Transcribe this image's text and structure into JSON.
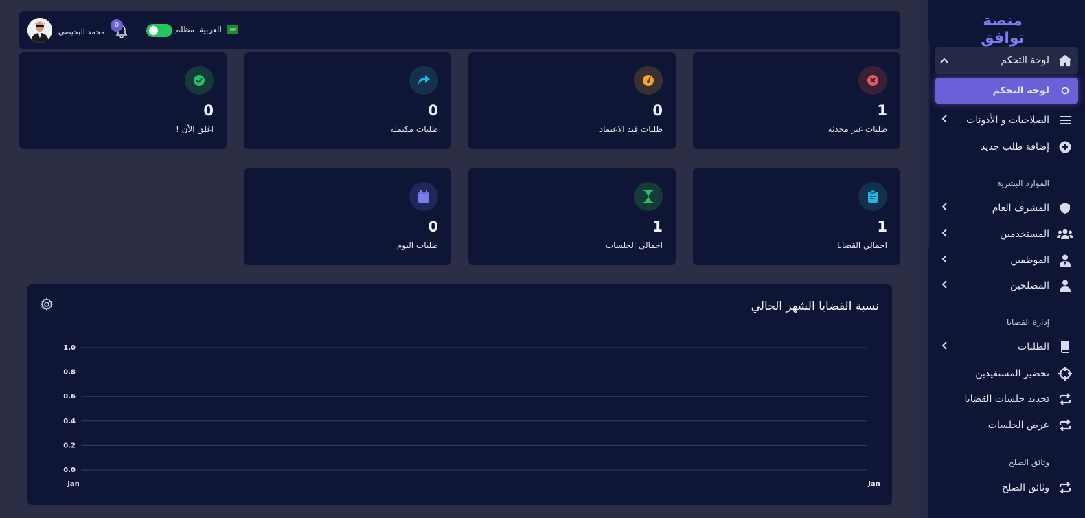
{
  "sidebar": {
    "brand": "منصة توافق",
    "items": [
      {
        "label": "لوحة التحكم",
        "icon": "home-icon",
        "chevron": "up"
      },
      {
        "label": "لوحة التحكم",
        "icon": "circle-icon"
      },
      {
        "label": "الصلاحيات و الأذونات",
        "icon": "menu-icon",
        "chevron": "left"
      },
      {
        "label": "إضافة طلب جديد",
        "icon": "plus-circle-icon"
      },
      {
        "label": "المشرف العام",
        "icon": "shield-icon",
        "chevron": "left"
      },
      {
        "label": "المستخدمين",
        "icon": "users-icon",
        "chevron": "left"
      },
      {
        "label": "الموظفين",
        "icon": "user-tie-icon",
        "chevron": "left"
      },
      {
        "label": "المصلحين",
        "icon": "user-icon",
        "chevron": "left"
      },
      {
        "label": "الطلبات",
        "icon": "book-icon",
        "chevron": "left"
      },
      {
        "label": "تحضير المستفيدين",
        "icon": "crosshair-icon"
      },
      {
        "label": "تحديد جلسات القضايا",
        "icon": "repeat-icon"
      },
      {
        "label": "عرض الجلسات",
        "icon": "repeat-icon"
      },
      {
        "label": "وثائق الصلح",
        "icon": "repeat-icon"
      }
    ],
    "sections": [
      "الموارد البشرية",
      "إدارة القضايا",
      "وثائق الصلح"
    ]
  },
  "topbar": {
    "username": "محمد البحيصي",
    "notifications": "0",
    "theme_label": "مظلم",
    "language": "العربية"
  },
  "cards": [
    {
      "value": "1",
      "title": "طلبات غير محدثة",
      "icon": "x-circle-icon",
      "color": "#e05a66",
      "bg": "#3a2036"
    },
    {
      "value": "0",
      "title": "طلبات قيد الاعتماد",
      "icon": "gauge-icon",
      "color": "#f5a623",
      "bg": "#3a3032"
    },
    {
      "value": "0",
      "title": "طلبات مكتملة",
      "icon": "share-icon",
      "color": "#1fb8e0",
      "bg": "#15304f"
    },
    {
      "value": "0",
      "title": "اغلق الأن !",
      "icon": "check-circle-icon",
      "color": "#22c55e",
      "bg": "#163a3a"
    },
    {
      "value": "1",
      "title": "اجمالي القضايا",
      "icon": "clipboard-icon",
      "color": "#1fb8e0",
      "bg": "#15304f"
    },
    {
      "value": "1",
      "title": "اجمالي الجلسات",
      "icon": "hourglass-icon",
      "color": "#22c55e",
      "bg": "#163a3a"
    },
    {
      "value": "0",
      "title": "طلبات اليوم",
      "icon": "calendar-icon",
      "color": "#7b7cf0",
      "bg": "#23265a"
    }
  ],
  "panel": {
    "title": "نسبة القضايا الشهر الحالي"
  },
  "chart_data": {
    "type": "line",
    "title": "نسبة القضايا الشهر الحالي",
    "x": [
      "Jan",
      "Jan"
    ],
    "y_ticks": [
      "1.0",
      "0.8",
      "0.6",
      "0.4",
      "0.2",
      "0.0"
    ],
    "ylim": [
      0,
      1
    ],
    "grid": true,
    "series": []
  }
}
